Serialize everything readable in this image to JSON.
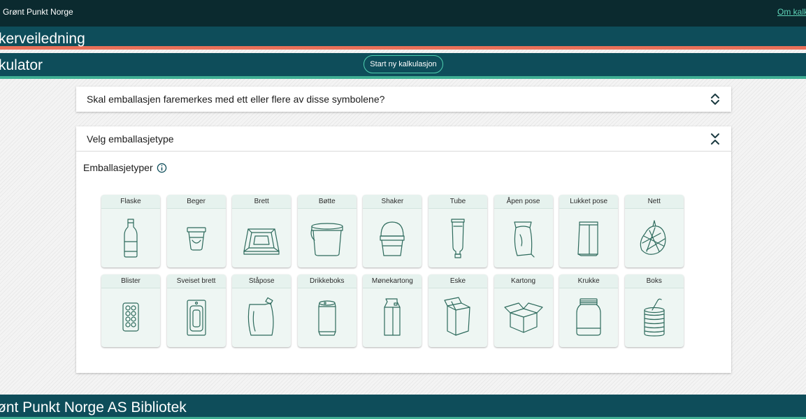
{
  "topbar": {
    "brand": "Grønt Punkt Norge",
    "about_link": "Om kalku"
  },
  "band1": {
    "title": "kerveiledning"
  },
  "band2": {
    "title": "kulator",
    "new_button": "Start ny kalkulasjon"
  },
  "accordion_hazard": {
    "title": "Skal emballasjen faremerkes med ett eller flere av disse symbolene?",
    "icon": "chevron-up-down-icon"
  },
  "accordion_type": {
    "title": "Velg emballasjetype",
    "icon": "collapse-icon",
    "subtitle": "Emballasjetyper",
    "info_icon": "info-icon"
  },
  "packaging_types": [
    {
      "label": "Flaske",
      "icon": "bottle"
    },
    {
      "label": "Beger",
      "icon": "cup"
    },
    {
      "label": "Brett",
      "icon": "tray"
    },
    {
      "label": "Bøtte",
      "icon": "bucket"
    },
    {
      "label": "Shaker",
      "icon": "shaker"
    },
    {
      "label": "Tube",
      "icon": "tube"
    },
    {
      "label": "Åpen pose",
      "icon": "open-bag"
    },
    {
      "label": "Lukket pose",
      "icon": "closed-bag"
    },
    {
      "label": "Nett",
      "icon": "net"
    },
    {
      "label": "Blister",
      "icon": "blister"
    },
    {
      "label": "Sveiset brett",
      "icon": "sealed-tray"
    },
    {
      "label": "Ståpose",
      "icon": "pouch"
    },
    {
      "label": "Drikkeboks",
      "icon": "can"
    },
    {
      "label": "Mønekartong",
      "icon": "gable-carton"
    },
    {
      "label": "Eske",
      "icon": "box"
    },
    {
      "label": "Kartong",
      "icon": "open-carton"
    },
    {
      "label": "Krukke",
      "icon": "jar"
    },
    {
      "label": "Boks",
      "icon": "tin"
    }
  ],
  "footer": {
    "title": "ønt Punkt Norge AS Bibliotek"
  },
  "colors": {
    "dark": "#0b2a2f",
    "teal": "#0e4d5a",
    "accent_green": "#3fae93",
    "accent_coral": "#e97059",
    "icon_green": "#2d6a5c"
  }
}
